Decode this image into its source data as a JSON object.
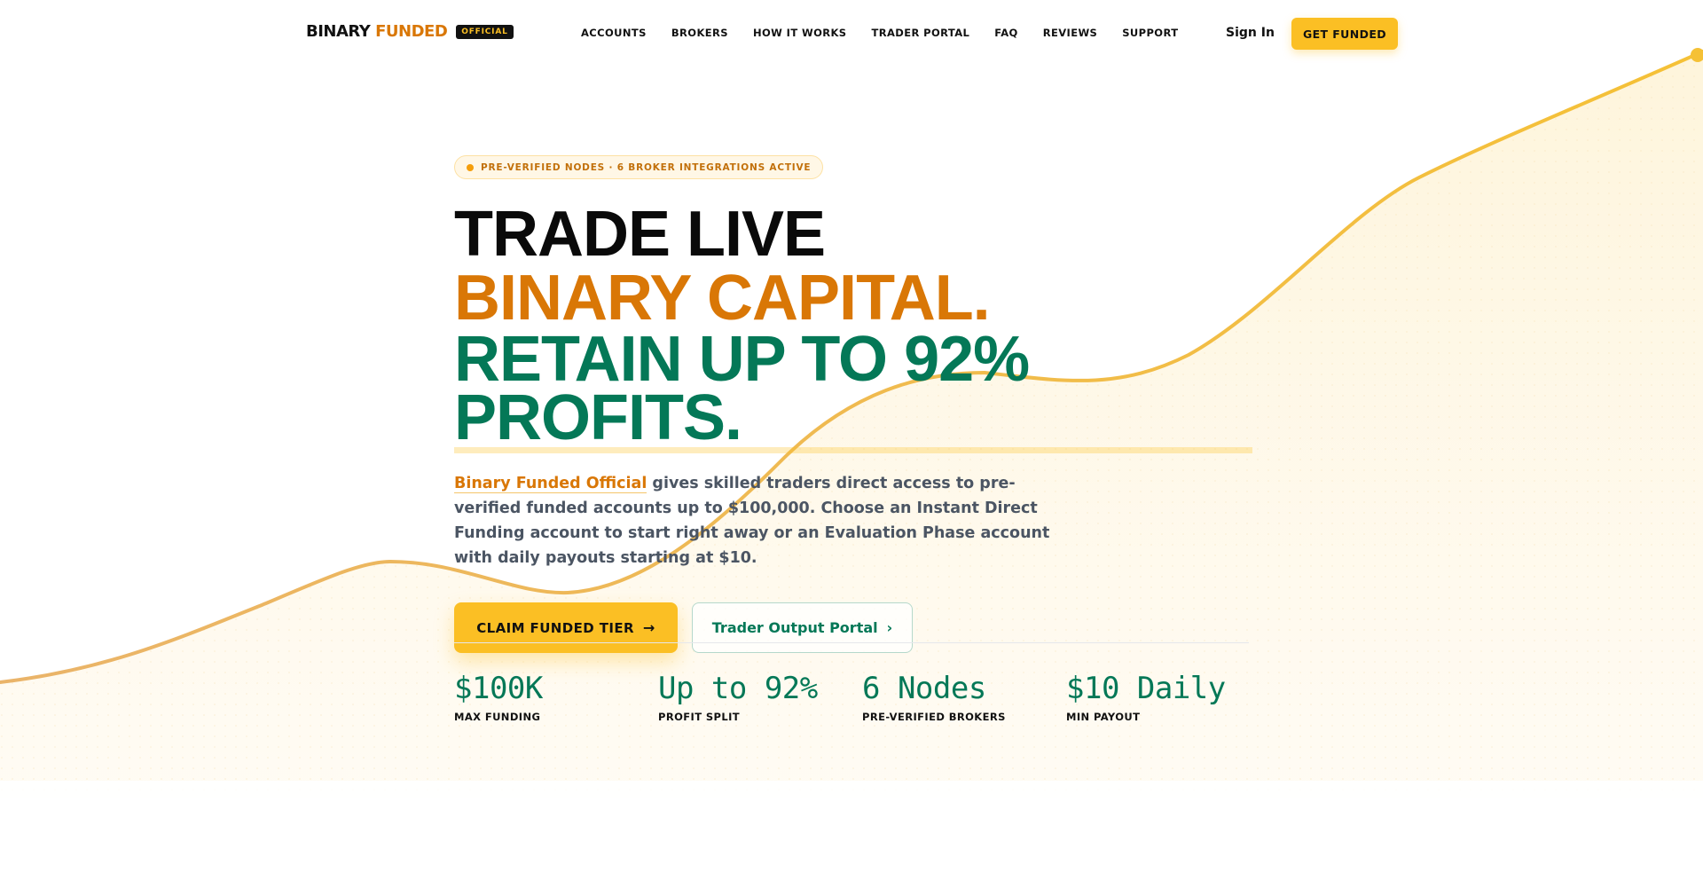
{
  "brand": {
    "word1": "BINARY",
    "word2": "FUNDED",
    "badge": "OFFICIAL"
  },
  "nav": {
    "items": [
      {
        "label": "ACCOUNTS"
      },
      {
        "label": "BROKERS"
      },
      {
        "label": "HOW IT WORKS"
      },
      {
        "label": "TRADER PORTAL"
      },
      {
        "label": "FAQ"
      },
      {
        "label": "REVIEWS"
      },
      {
        "label": "SUPPORT"
      }
    ],
    "signin_label": "Sign In",
    "cta_label": "GET FUNDED"
  },
  "hero": {
    "pill": "PRE-VERIFIED NODES · 6 BROKER INTEGRATIONS ACTIVE",
    "title_line1": "TRADE LIVE",
    "title_line2": "BINARY CAPITAL.",
    "title_line3": "RETAIN UP TO 92% PROFITS.",
    "lead_brand": "Binary Funded Official",
    "lead_rest": " gives skilled traders direct access to pre-verified funded accounts up to $100,000. Choose an Instant Direct Funding account to start right away or an Evaluation Phase account with daily payouts starting at $10.",
    "primary_cta": "CLAIM FUNDED TIER",
    "secondary_cta": "Trader Output Portal"
  },
  "stats": [
    {
      "value": "$100K",
      "label": "MAX FUNDING"
    },
    {
      "value": "Up to 92%",
      "label": "PROFIT SPLIT"
    },
    {
      "value": "6 Nodes",
      "label": "PRE-VERIFIED BROKERS"
    },
    {
      "value": "$10 Daily",
      "label": "MIN PAYOUT"
    }
  ],
  "colors": {
    "accent": "#fbbf24",
    "orange": "#d97706",
    "green": "#047857"
  },
  "icons": {
    "primary_cta": "arrow-right-icon",
    "secondary_cta": "chevron-right-icon"
  }
}
